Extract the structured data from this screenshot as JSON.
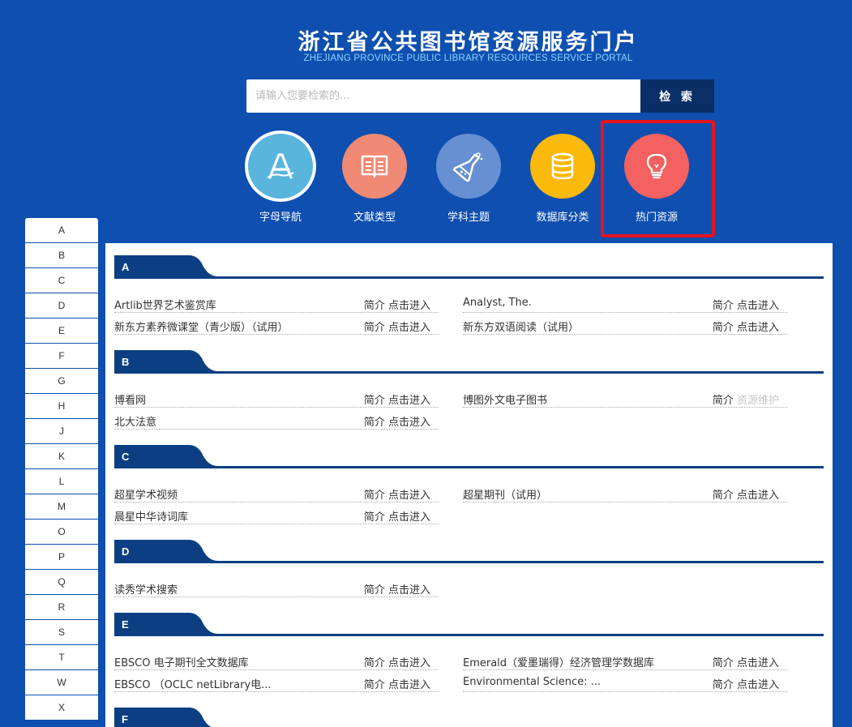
{
  "header": {
    "title_cn": "浙江省公共图书馆资源服务门户",
    "title_en": "ZHEJIANG PROVINCE PUBLIC LIBRARY RESOURCES SERVICE PORTAL"
  },
  "search": {
    "placeholder": "请输入您要检索的...",
    "value": "",
    "button_label": "检 索"
  },
  "navs": [
    {
      "label": "字母导航",
      "icon": "letter-a-icon",
      "color": "#5ab5dd"
    },
    {
      "label": "文献类型",
      "icon": "book-icon",
      "color": "#f18a74"
    },
    {
      "label": "学科主题",
      "icon": "flask-icon",
      "color": "#6690d2"
    },
    {
      "label": "数据库分类",
      "icon": "database-icon",
      "color": "#fbb90c"
    },
    {
      "label": "热门资源",
      "icon": "lightbulb-icon",
      "color": "#f36161"
    }
  ],
  "letters": [
    "A",
    "B",
    "C",
    "D",
    "E",
    "F",
    "G",
    "H",
    "J",
    "K",
    "L",
    "M",
    "O",
    "P",
    "Q",
    "R",
    "S",
    "T",
    "W",
    "X"
  ],
  "sections": [
    {
      "letter": "A",
      "items": [
        {
          "name": "Artlib世界艺术鉴赏库",
          "intro": "简介",
          "action": "点击进入"
        },
        {
          "name": "Analyst, The.",
          "intro": "简介",
          "action": "点击进入"
        },
        {
          "name": "新东方素养微课堂（青少版）（试用）",
          "intro": "简介",
          "action": "点击进入"
        },
        {
          "name": "新东方双语阅读（试用）",
          "intro": "简介",
          "action": "点击进入"
        }
      ]
    },
    {
      "letter": "B",
      "items": [
        {
          "name": "博看网",
          "intro": "简介",
          "action": "点击进入"
        },
        {
          "name": "博图外文电子图书",
          "intro": "简介",
          "action": "资源维护"
        },
        {
          "name": "北大法意",
          "intro": "简介",
          "action": "点击进入"
        }
      ]
    },
    {
      "letter": "C",
      "items": [
        {
          "name": "超星学术视频",
          "intro": "简介",
          "action": "点击进入"
        },
        {
          "name": "超星期刊（试用）",
          "intro": "简介",
          "action": "点击进入"
        },
        {
          "name": "晨星中华诗词库",
          "intro": "简介",
          "action": "点击进入"
        }
      ]
    },
    {
      "letter": "D",
      "items": [
        {
          "name": "读秀学术搜索",
          "intro": "简介",
          "action": "点击进入"
        }
      ]
    },
    {
      "letter": "E",
      "items": [
        {
          "name": "EBSCO 电子期刊全文数据库",
          "intro": "简介",
          "action": "点击进入"
        },
        {
          "name": "Emerald（爱墨瑞得）经济管理学数据库",
          "intro": "简介",
          "action": "点击进入"
        },
        {
          "name": "EBSCO （OCLC netLibrary电...",
          "intro": "简介",
          "action": "点击进入"
        },
        {
          "name": "Environmental Science: ...",
          "intro": "简介",
          "action": "点击进入"
        }
      ]
    },
    {
      "letter": "F",
      "items": []
    }
  ],
  "colors": {
    "background": "#0e4fb0",
    "header_dark": "#0a2f66",
    "section_tab": "#0c3f82",
    "highlight": "#e8141c",
    "maintenance_text": "#c6c6c6"
  }
}
